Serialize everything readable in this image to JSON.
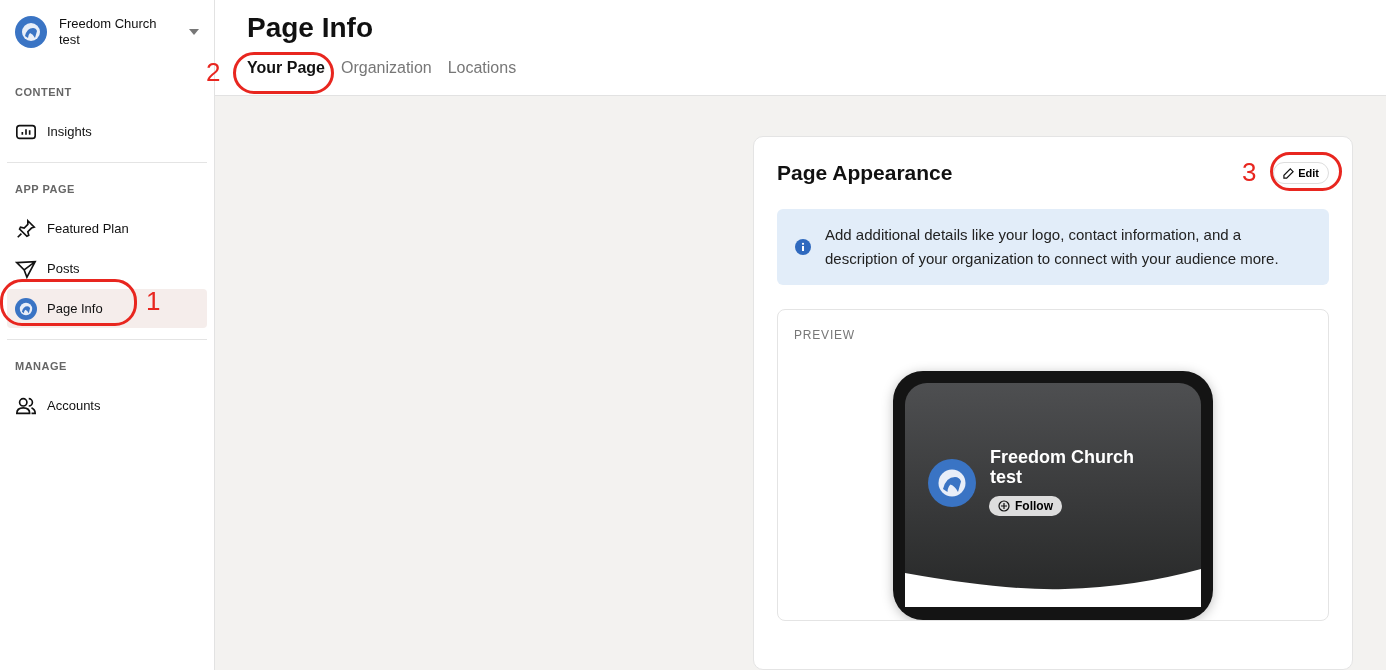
{
  "sidebar": {
    "org": {
      "name": "Freedom Church test"
    },
    "sections": [
      {
        "heading": "CONTENT",
        "items": [
          {
            "label": "Insights",
            "kind": "chart",
            "selected": false
          }
        ]
      },
      {
        "heading": "APP PAGE",
        "items": [
          {
            "label": "Featured Plan",
            "kind": "pin",
            "selected": false
          },
          {
            "label": "Posts",
            "kind": "send",
            "selected": false
          },
          {
            "label": "Page Info",
            "kind": "avatar",
            "selected": true
          }
        ]
      },
      {
        "heading": "MANAGE",
        "items": [
          {
            "label": "Accounts",
            "kind": "people",
            "selected": false
          }
        ]
      }
    ]
  },
  "header": {
    "title": "Page Info",
    "tabs": [
      {
        "label": "Your Page",
        "selected": true
      },
      {
        "label": "Organization",
        "selected": false
      },
      {
        "label": "Locations",
        "selected": false
      }
    ]
  },
  "card": {
    "title": "Page Appearance",
    "edit_button": "Edit",
    "info": "Add additional details like your logo, contact information, and a description of your organization to connect with your audience more.",
    "preview": {
      "label": "PREVIEW",
      "name": "Freedom Church test",
      "follow_button": "Follow"
    }
  },
  "annotations": [
    {
      "number": "1"
    },
    {
      "number": "2"
    },
    {
      "number": "3"
    }
  ]
}
